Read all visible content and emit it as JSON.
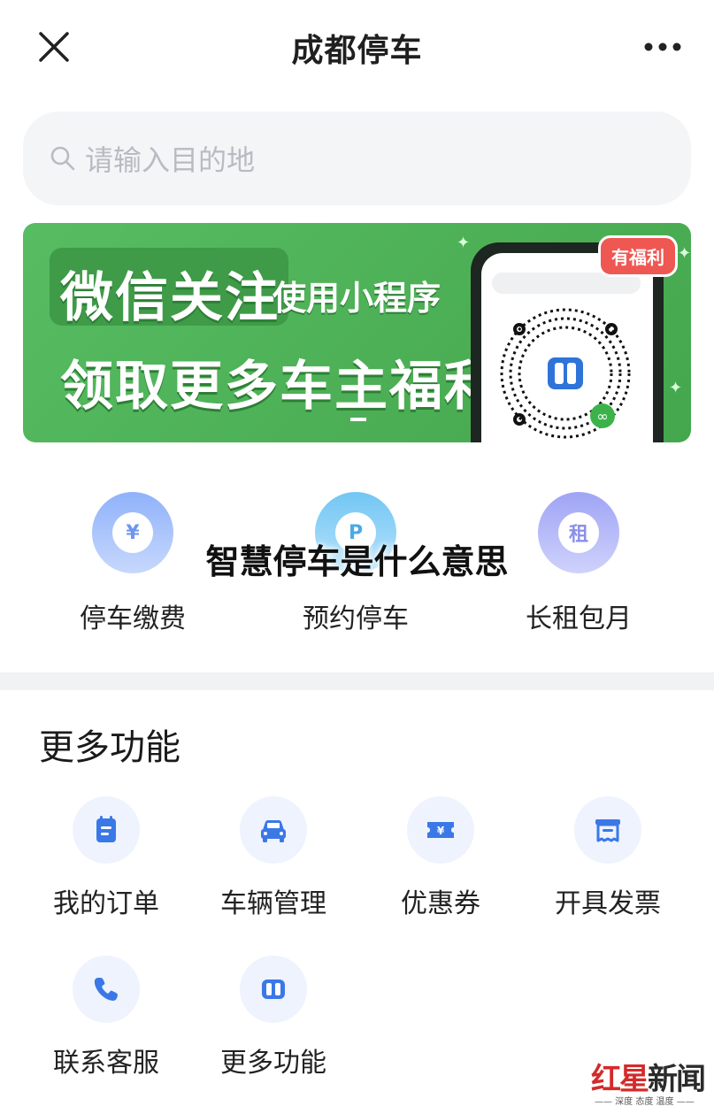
{
  "header": {
    "title": "成都停车",
    "close_icon": "close-icon",
    "more_icon": "more-dots-icon"
  },
  "search": {
    "placeholder": "请输入目的地",
    "icon": "search-icon"
  },
  "banner": {
    "line1a": "微信关注",
    "line1b": "使用小程序",
    "line2": "领取更多车主福利",
    "badge": "有福利",
    "qr_icon": "mini-program-qr-icon"
  },
  "services": [
    {
      "label": "停车缴费",
      "icon_char": "¥",
      "icon": "parking-payment-icon"
    },
    {
      "label": "预约停车",
      "icon_char": "P",
      "icon": "reserve-parking-icon"
    },
    {
      "label": "长租包月",
      "icon_char": "租",
      "icon": "monthly-rent-icon"
    }
  ],
  "overlay_caption": "智慧停车是什么意思",
  "more_section": {
    "title": "更多功能",
    "items": [
      {
        "label": "我的订单",
        "icon": "order-icon"
      },
      {
        "label": "车辆管理",
        "icon": "car-icon"
      },
      {
        "label": "优惠券",
        "icon": "coupon-icon"
      },
      {
        "label": "开具发票",
        "icon": "invoice-icon"
      },
      {
        "label": "联系客服",
        "icon": "phone-icon"
      },
      {
        "label": "更多功能",
        "icon": "more-app-icon"
      }
    ]
  },
  "watermark": {
    "brand_red": "红星",
    "brand_dark": "新闻",
    "sub": "—— 深度 态度 温度 ——"
  },
  "colors": {
    "accent_blue": "#3b78e7",
    "banner_green": "#4caf55",
    "badge_red": "#ef5753",
    "icon_bg": "#eef3fd"
  }
}
